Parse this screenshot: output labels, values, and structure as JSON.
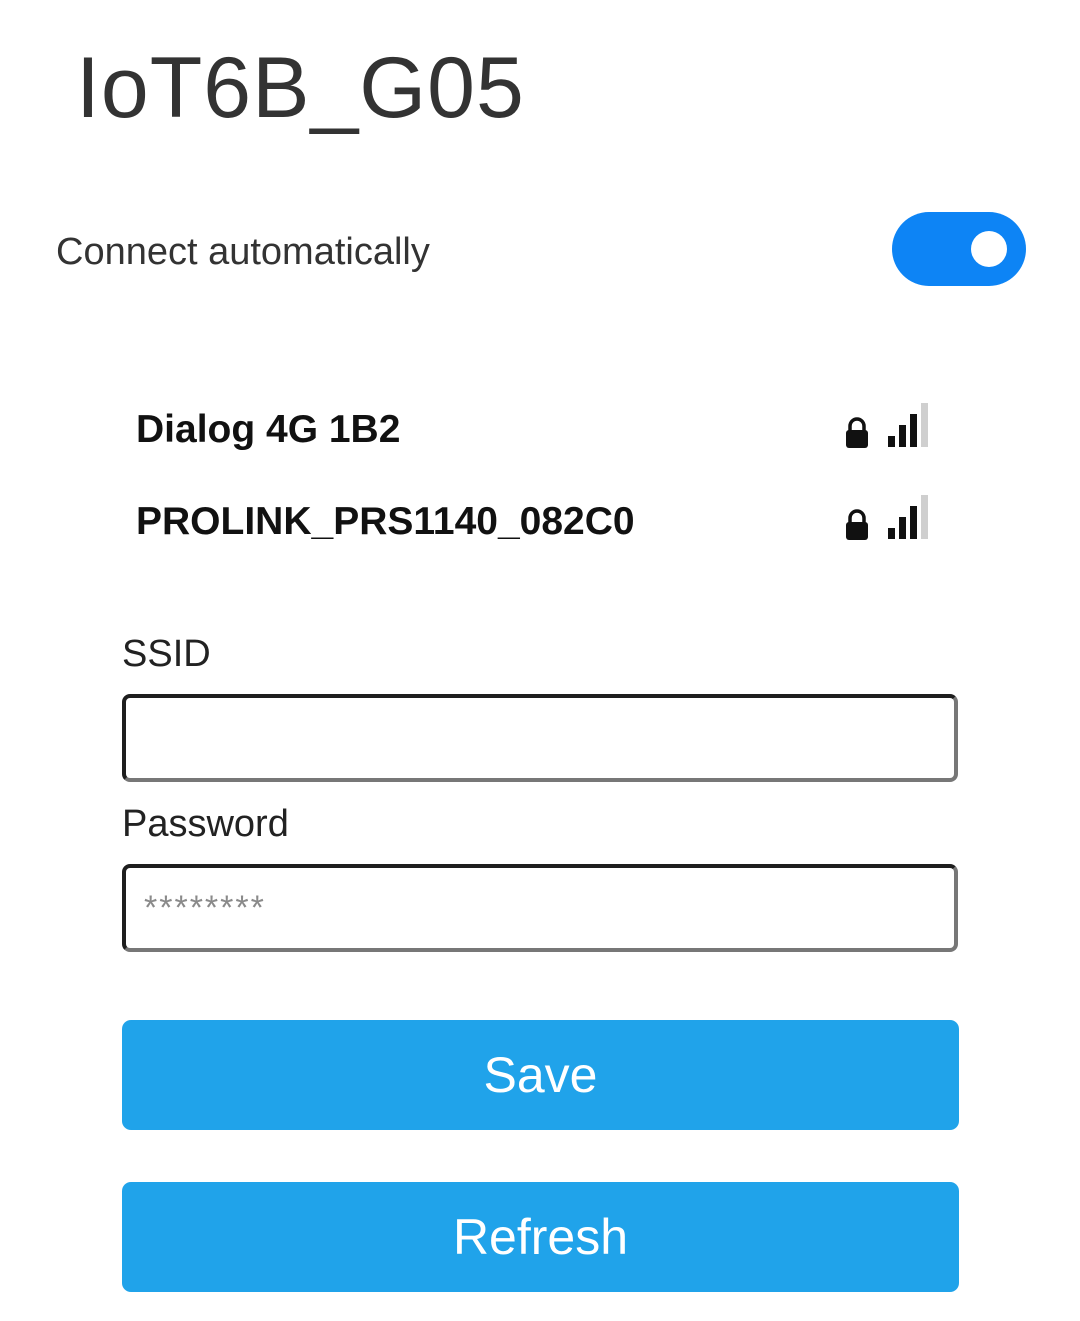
{
  "header": {
    "title": "IoT6B_G05"
  },
  "auto_connect": {
    "label": "Connect automatically",
    "enabled": true,
    "accent_color": "#0d84f5"
  },
  "networks": [
    {
      "ssid": "Dialog 4G 1B2",
      "secured": true,
      "signal_bars": 3,
      "signal_max": 4
    },
    {
      "ssid": "PROLINK_PRS1140_082C0",
      "secured": true,
      "signal_bars": 3,
      "signal_max": 4
    }
  ],
  "form": {
    "ssid_label": "SSID",
    "ssid_value": "",
    "ssid_placeholder": "",
    "password_label": "Password",
    "password_value": "",
    "password_placeholder": "********"
  },
  "buttons": {
    "save_label": "Save",
    "refresh_label": "Refresh",
    "color": "#20a3ea"
  },
  "icons": {
    "lock": "lock-icon",
    "signal": "wifi-signal-icon"
  }
}
